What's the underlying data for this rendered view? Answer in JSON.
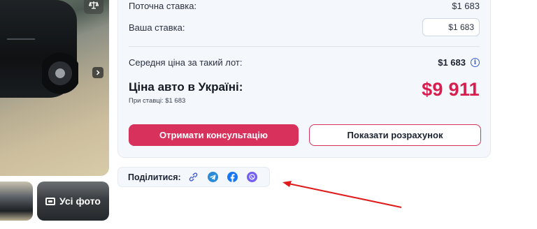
{
  "gallery": {
    "all_photos_label": "Усі фото"
  },
  "price_card": {
    "current_bid_label": "Поточна ставка:",
    "current_bid_value": "$1 683",
    "your_bid_label": "Ваша ставка:",
    "your_bid_value": "$1 683",
    "avg_price_label": "Середня ціна за такий лот:",
    "avg_price_value": "$1 683",
    "ukraine_price_title": "Ціна авто в Україні:",
    "ukraine_price_sub": "При ставці: $1 683",
    "ukraine_price_value": "$9 911",
    "consult_button": "Отримати консультацію",
    "calc_button": "Показати розрахунок"
  },
  "share": {
    "label": "Поділитися:",
    "icons": [
      "link-icon",
      "telegram-icon",
      "facebook-icon",
      "viber-icon"
    ]
  },
  "colors": {
    "accent": "#d8315b",
    "price_red": "#d81e4f",
    "info_blue": "#3b5bd6",
    "arrow_red": "#e01b1b"
  }
}
